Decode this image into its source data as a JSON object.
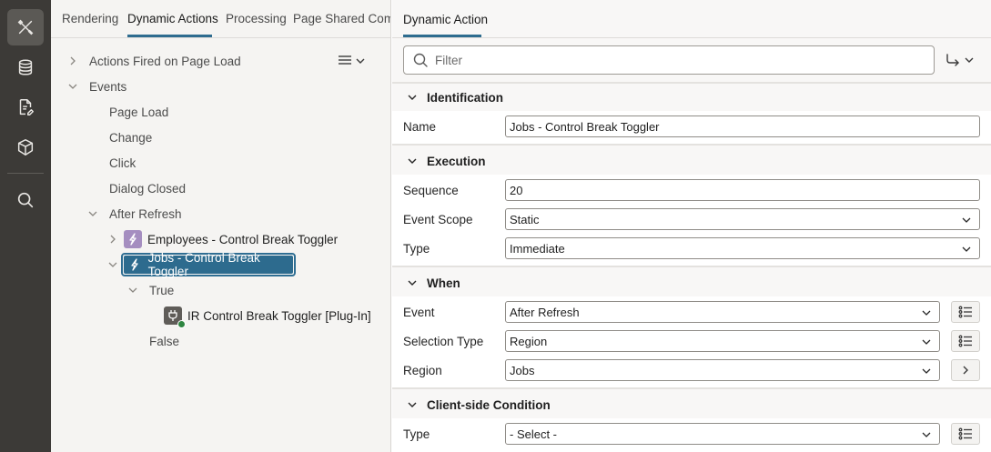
{
  "toolbar": {
    "items": [
      {
        "icon": "tools-icon",
        "active": true
      },
      {
        "icon": "database-icon",
        "active": false
      },
      {
        "icon": "page-edit-icon",
        "active": false
      },
      {
        "icon": "package-icon",
        "active": false
      },
      {
        "icon": "search-icon",
        "active": false
      }
    ]
  },
  "tree": {
    "tabs": [
      "Rendering",
      "Dynamic Actions",
      "Processing",
      "Page Shared Components"
    ],
    "active_tab": "Dynamic Actions",
    "nodes": {
      "actions_fired": "Actions Fired on Page Load",
      "events": "Events",
      "page_load": "Page Load",
      "change": "Change",
      "click": "Click",
      "dialog_closed": "Dialog Closed",
      "after_refresh": "After Refresh",
      "employees_da": "Employees - Control Break Toggler",
      "jobs_da": "Jobs - Control Break Toggler",
      "true_branch": "True",
      "plugin_action": "IR Control Break Toggler [Plug-In]",
      "false_branch": "False"
    },
    "selected": "Jobs - Control Break Toggler"
  },
  "property_editor": {
    "tab": "Dynamic Action",
    "filter_placeholder": "Filter",
    "groups": {
      "identification": {
        "title": "Identification",
        "name_label": "Name",
        "name_value": "Jobs - Control Break Toggler"
      },
      "execution": {
        "title": "Execution",
        "sequence_label": "Sequence",
        "sequence_value": "20",
        "event_scope_label": "Event Scope",
        "event_scope_value": "Static",
        "type_label": "Type",
        "type_value": "Immediate"
      },
      "when": {
        "title": "When",
        "event_label": "Event",
        "event_value": "After Refresh",
        "selection_type_label": "Selection Type",
        "selection_type_value": "Region",
        "region_label": "Region",
        "region_value": "Jobs"
      },
      "client_condition": {
        "title": "Client-side Condition",
        "type_label": "Type",
        "type_value": "- Select -"
      }
    }
  },
  "colors": {
    "toolbar_bg": "#3c3a37",
    "accent": "#2d6b8e",
    "da_icon": "#a58ec0"
  }
}
